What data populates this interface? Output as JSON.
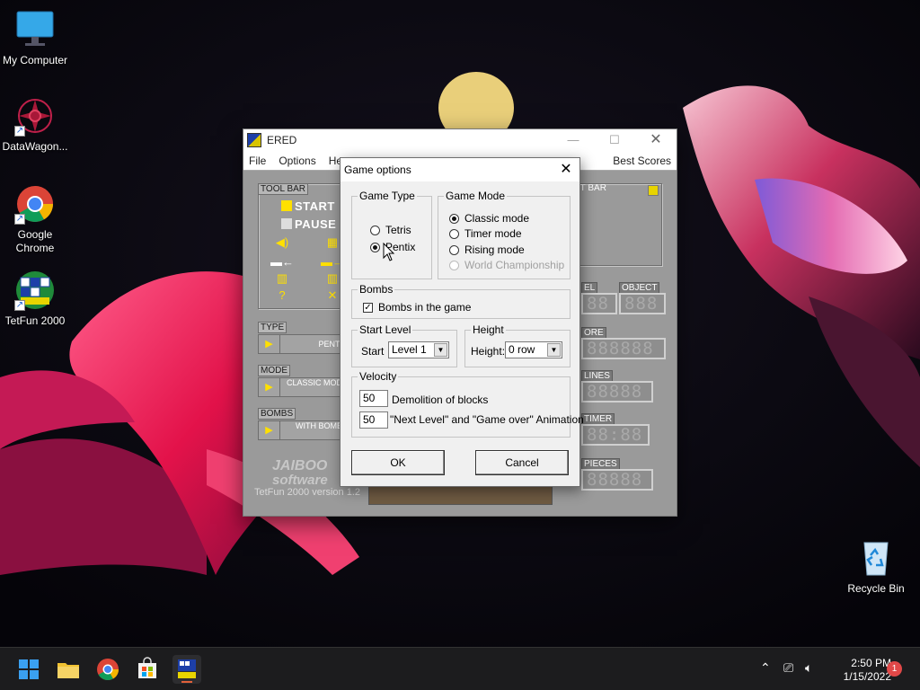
{
  "desktop": {
    "icons": [
      {
        "label": "My Computer",
        "icon": "monitor-icon"
      },
      {
        "label": "DataWagon...",
        "icon": "datawagon-icon"
      },
      {
        "label": "Google Chrome",
        "icon": "chrome-icon"
      },
      {
        "label": "TetFun 2000",
        "icon": "tetfun-icon"
      },
      {
        "label": "Recycle Bin",
        "icon": "recycle-bin-icon"
      }
    ]
  },
  "game_window": {
    "title": "ERED",
    "menu": [
      "File",
      "Options",
      "He"
    ],
    "menu_right": "Best Scores",
    "tool_bar_label": "TOOL BAR",
    "start_label": "START",
    "pause_label": "PAUSE",
    "next_bar_label": "XT BAR",
    "type_label": "TYPE",
    "type_value": "PENTIX",
    "mode_label": "MODE",
    "mode_value": "CLASSIC MODE",
    "bombs_label": "BOMBS",
    "bombs_value": "WITH BOMBS",
    "level_label": "EL",
    "object_label": "OBJECT",
    "score_label": "ORE",
    "lines_label": "LINES",
    "timer_label": "TIMER",
    "pieces_label": "PIECES",
    "seg_level": "88",
    "seg_object": "888",
    "seg_score": "888888",
    "seg_lines": "88888",
    "seg_timer": "88:88",
    "seg_pieces": "88888",
    "logo_line1": "JAIBOO",
    "logo_line2": "software",
    "version": "TetFun 2000 version 1.2"
  },
  "dialog": {
    "title": "Game options",
    "game_type": {
      "title": "Game Type",
      "options": [
        "Tetris",
        "Pentix"
      ],
      "selected": "Pentix"
    },
    "game_mode": {
      "title": "Game Mode",
      "options": [
        "Classic mode",
        "Timer mode",
        "Rising mode",
        "World Championship"
      ],
      "selected": "Classic mode",
      "disabled": "World Championship"
    },
    "bombs": {
      "title": "Bombs",
      "checkbox_label": "Bombs in the game",
      "checked": true
    },
    "start_level": {
      "title": "Start Level",
      "label": "Start",
      "value": "Level 1"
    },
    "height": {
      "title": "Height",
      "label": "Height:",
      "value": "0 row"
    },
    "velocity": {
      "title": "Velocity",
      "demolition_value": "50",
      "demolition_label": "Demolition of blocks",
      "animation_value": "50",
      "animation_label": "\"Next Level\" and \"Game over\" Animation"
    },
    "ok_label": "OK",
    "cancel_label": "Cancel"
  },
  "taskbar": {
    "apps": [
      "start-icon",
      "file-explorer-icon",
      "chrome-icon",
      "store-icon",
      "tetfun-icon"
    ],
    "time": "2:50 PM",
    "date": "1/15/2022",
    "notification_count": "1"
  }
}
